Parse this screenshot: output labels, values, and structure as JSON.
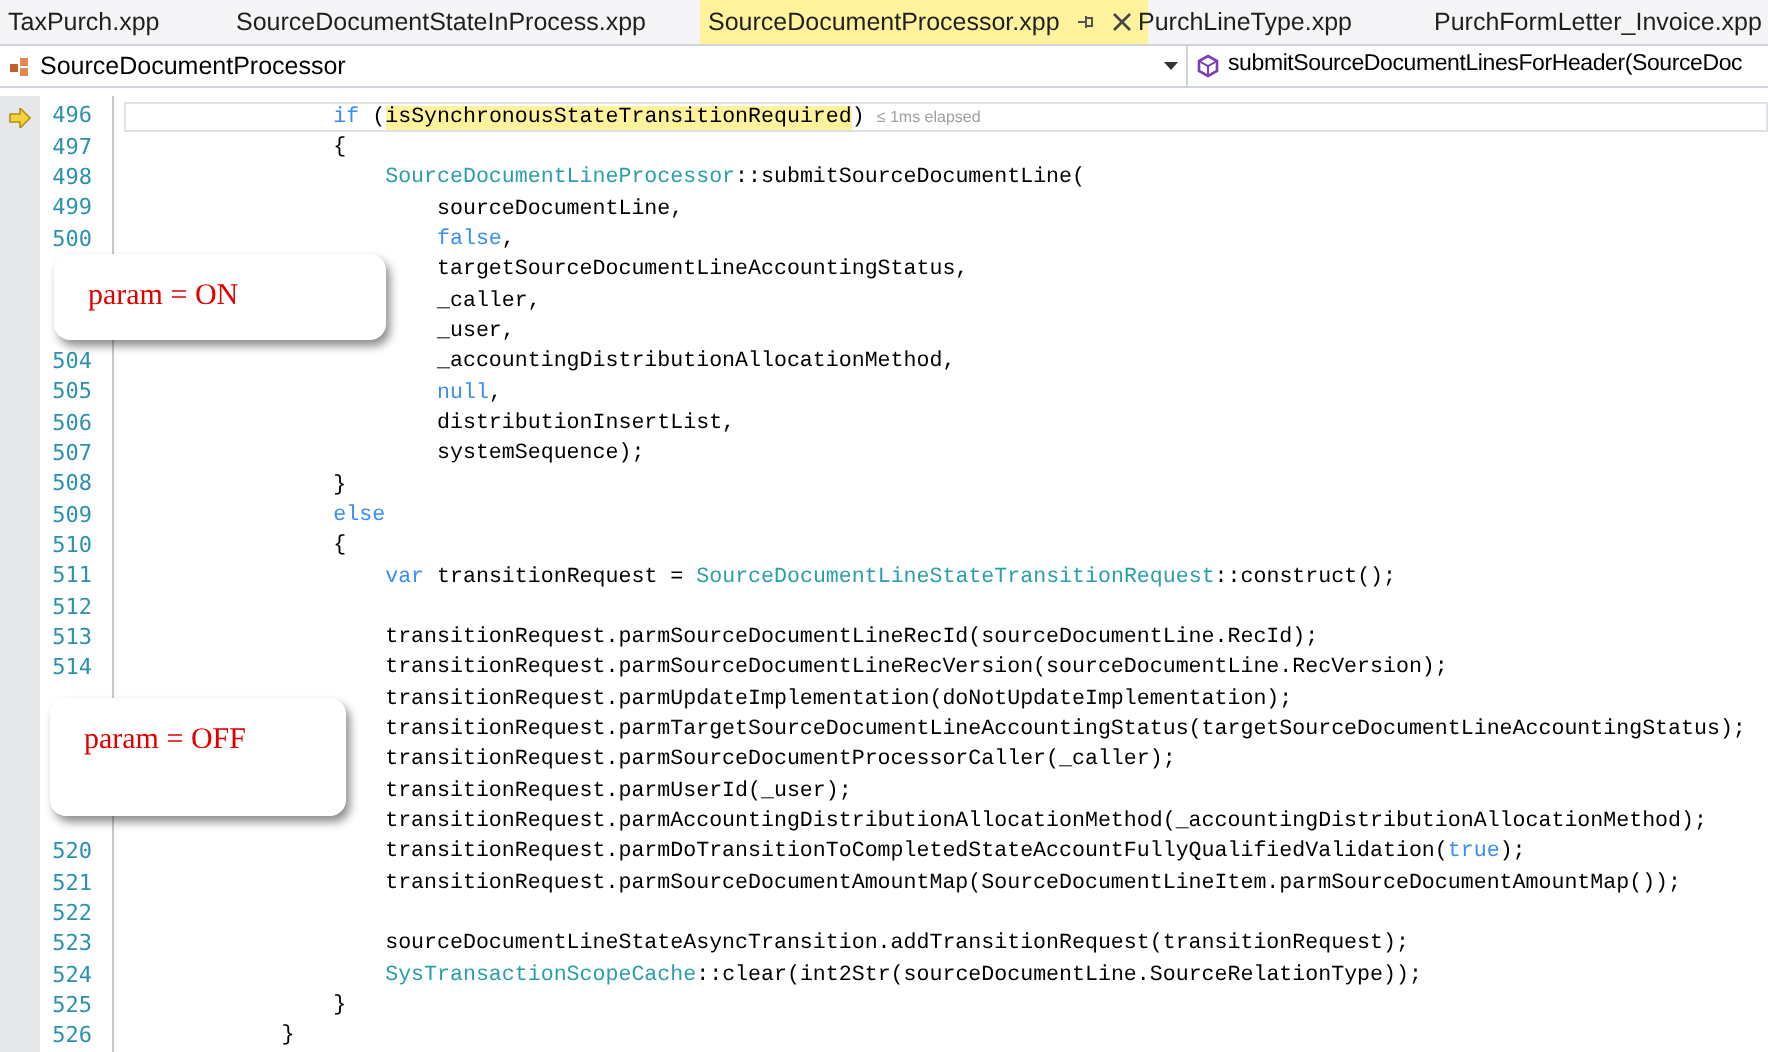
{
  "tabs": [
    {
      "label": "TaxPurch.xpp",
      "selected": false
    },
    {
      "label": "SourceDocumentStateInProcess.xpp",
      "selected": false
    },
    {
      "label": "SourceDocumentProcessor.xpp",
      "selected": true
    },
    {
      "label": "PurchLineType.xpp",
      "selected": false
    },
    {
      "label": "PurchFormLetter_Invoice.xpp",
      "selected": false
    }
  ],
  "navigation": {
    "type_dropdown": "SourceDocumentProcessor",
    "member_dropdown": "submitSourceDocumentLinesForHeader(SourceDoc"
  },
  "editor": {
    "lines": [
      {
        "number": "496",
        "current": true,
        "elapsed": "≤ 1ms elapsed",
        "tokens": [
          {
            "kind": "keyword",
            "text": "                if"
          },
          {
            "kind": "plain",
            "text": " ("
          },
          {
            "kind": "highlight",
            "text": "isSynchronousStateTransitionRequired"
          },
          {
            "kind": "plain",
            "text": ")"
          }
        ]
      },
      {
        "number": "497",
        "current": false,
        "tokens": [
          {
            "kind": "plain",
            "text": "                {"
          }
        ]
      },
      {
        "number": "498",
        "current": false,
        "tokens": [
          {
            "kind": "type",
            "text": "                    SourceDocumentLineProcessor"
          },
          {
            "kind": "plain",
            "text": "::submitSourceDocumentLine("
          }
        ]
      },
      {
        "number": "499",
        "current": false,
        "tokens": [
          {
            "kind": "plain",
            "text": "                        sourceDocumentLine,"
          }
        ]
      },
      {
        "number": "500",
        "current": false,
        "tokens": [
          {
            "kind": "keyword",
            "text": "                        false"
          },
          {
            "kind": "plain",
            "text": ","
          }
        ]
      },
      {
        "current": false,
        "tokens": [
          {
            "kind": "plain",
            "text": "                        targetSourceDocumentLineAccountingStatus,"
          }
        ]
      },
      {
        "current": false,
        "tokens": [
          {
            "kind": "plain",
            "text": "                        _caller,"
          }
        ]
      },
      {
        "current": false,
        "tokens": [
          {
            "kind": "plain",
            "text": "                        _user,"
          }
        ]
      },
      {
        "number": "504",
        "current": false,
        "tokens": [
          {
            "kind": "plain",
            "text": "                        _accountingDistributionAllocationMethod,"
          }
        ]
      },
      {
        "number": "505",
        "current": false,
        "tokens": [
          {
            "kind": "keyword",
            "text": "                        null"
          },
          {
            "kind": "plain",
            "text": ","
          }
        ]
      },
      {
        "number": "506",
        "current": false,
        "tokens": [
          {
            "kind": "plain",
            "text": "                        distributionInsertList,"
          }
        ]
      },
      {
        "number": "507",
        "current": false,
        "tokens": [
          {
            "kind": "plain",
            "text": "                        systemSequence);"
          }
        ]
      },
      {
        "number": "508",
        "current": false,
        "tokens": [
          {
            "kind": "plain",
            "text": "                }"
          }
        ]
      },
      {
        "number": "509",
        "current": false,
        "tokens": [
          {
            "kind": "keyword",
            "text": "                else"
          }
        ]
      },
      {
        "number": "510",
        "current": false,
        "tokens": [
          {
            "kind": "plain",
            "text": "                {"
          }
        ]
      },
      {
        "number": "511",
        "current": false,
        "tokens": [
          {
            "kind": "keyword",
            "text": "                    var"
          },
          {
            "kind": "plain",
            "text": " transitionRequest = "
          },
          {
            "kind": "type",
            "text": "SourceDocumentLineStateTransitionRequest"
          },
          {
            "kind": "plain",
            "text": "::construct();"
          }
        ]
      },
      {
        "number": "512",
        "current": false
      },
      {
        "number": "513",
        "current": false,
        "tokens": [
          {
            "kind": "plain",
            "text": "                    transitionRequest.parmSourceDocumentLineRecId(sourceDocumentLine.RecId);"
          }
        ]
      },
      {
        "number": "514",
        "current": false,
        "tokens": [
          {
            "kind": "plain",
            "text": "                    transitionRequest.parmSourceDocumentLineRecVersion(sourceDocumentLine.RecVersion);"
          }
        ]
      },
      {
        "current": false,
        "tokens": [
          {
            "kind": "plain",
            "text": "                    transitionRequest.parmUpdateImplementation(doNotUpdateImplementation);"
          }
        ]
      },
      {
        "current": false,
        "tokens": [
          {
            "kind": "plain",
            "text": "                    transitionRequest.parmTargetSourceDocumentLineAccountingStatus(targetSourceDocumentLineAccountingStatus);"
          }
        ]
      },
      {
        "current": false,
        "tokens": [
          {
            "kind": "plain",
            "text": "                    transitionRequest.parmSourceDocumentProcessorCaller(_caller);"
          }
        ]
      },
      {
        "current": false,
        "tokens": [
          {
            "kind": "plain",
            "text": "                    transitionRequest.parmUserId(_user);"
          }
        ]
      },
      {
        "current": false,
        "tokens": [
          {
            "kind": "plain",
            "text": "                    transitionRequest.parmAccountingDistributionAllocationMethod(_accountingDistributionAllocationMethod);"
          }
        ]
      },
      {
        "number": "520",
        "current": false,
        "tokens": [
          {
            "kind": "plain",
            "text": "                    transitionRequest.parmDoTransitionToCompletedStateAccountFullyQualifiedValidation("
          },
          {
            "kind": "keyword",
            "text": "true"
          },
          {
            "kind": "plain",
            "text": ");"
          }
        ]
      },
      {
        "number": "521",
        "current": false,
        "tokens": [
          {
            "kind": "plain",
            "text": "                    transitionRequest.parmSourceDocumentAmountMap(SourceDocumentLineItem.parmSourceDocumentAmountMap());"
          }
        ]
      },
      {
        "number": "522",
        "current": false
      },
      {
        "number": "523",
        "current": false,
        "tokens": [
          {
            "kind": "plain",
            "text": "                    sourceDocumentLineStateAsyncTransition.addTransitionRequest(transitionRequest);"
          }
        ]
      },
      {
        "number": "524",
        "current": false,
        "tokens": [
          {
            "kind": "type",
            "text": "                    SysTransactionScopeCache"
          },
          {
            "kind": "plain",
            "text": "::clear(int2Str(sourceDocumentLine.SourceRelationType));"
          }
        ]
      },
      {
        "number": "525",
        "current": false,
        "tokens": [
          {
            "kind": "plain",
            "text": "                }"
          }
        ]
      },
      {
        "number": "526",
        "current": false,
        "tokens": [
          {
            "kind": "plain",
            "text": "            }"
          }
        ]
      }
    ]
  },
  "callouts": [
    "param = ON",
    "param = OFF"
  ]
}
